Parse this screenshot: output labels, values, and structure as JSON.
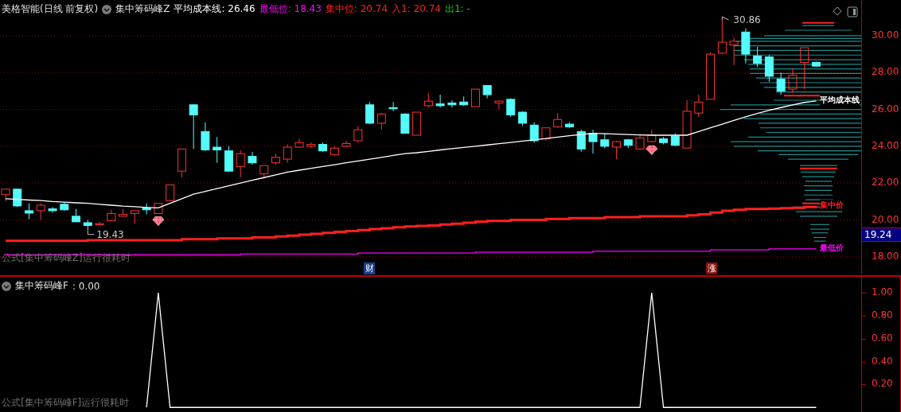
{
  "header": {
    "stock": "美格智能(日线 前复权)",
    "indicator": "集中筹码峰Z",
    "items": [
      {
        "label": "平均成本线:",
        "value": "26.46",
        "color": "#ffffff"
      },
      {
        "label": "最低位:",
        "value": "18.43",
        "color": "#ff00ff"
      },
      {
        "label": "集中位:",
        "value": "20.74",
        "color": "#ff2020"
      },
      {
        "label": "入1:",
        "value": "20.74",
        "color": "#ff2020"
      },
      {
        "label": "出1:",
        "value": "-",
        "color": "#00e000"
      }
    ]
  },
  "main_chart": {
    "high_marker": "30.86",
    "low_marker": "19.43",
    "price_tag": "19.24",
    "formula_note": "公式[集中筹码峰Z]运行很耗时",
    "badges": [
      {
        "text": "财",
        "kind": "finance"
      },
      {
        "text": "涨",
        "kind": "limit-up"
      }
    ],
    "chart_data": {
      "type": "candlestick",
      "grid": true,
      "ylim": [
        17.0,
        31.94
      ],
      "yticks": [
        {
          "value": 18,
          "label": "18.00"
        },
        {
          "value": 20,
          "label": "20.00"
        },
        {
          "value": 22,
          "label": "22.00"
        },
        {
          "value": 24,
          "label": "24.00"
        },
        {
          "value": 26,
          "label": "26.00"
        },
        {
          "value": 28,
          "label": "28.00"
        },
        {
          "value": 30,
          "label": "30.00"
        }
      ],
      "series": [
        {
          "name": "平均成本线",
          "type": "line",
          "color": "#ffffff",
          "values": [
            21.15,
            21.12,
            21.08,
            21.05,
            21.0,
            20.97,
            20.93,
            20.9,
            20.85,
            20.8,
            20.75,
            20.72,
            20.68,
            20.65,
            20.9,
            21.15,
            21.4,
            21.55,
            21.7,
            21.85,
            22.0,
            22.15,
            22.3,
            22.45,
            22.6,
            22.7,
            22.8,
            22.9,
            23.0,
            23.1,
            23.2,
            23.3,
            23.4,
            23.5,
            23.6,
            23.65,
            23.72,
            23.8,
            23.87,
            23.94,
            24.0,
            24.07,
            24.14,
            24.21,
            24.28,
            24.35,
            24.42,
            24.5,
            24.57,
            24.64,
            24.7,
            24.68,
            24.66,
            24.64,
            24.62,
            24.6,
            24.6,
            24.6,
            24.6,
            24.8,
            25.0,
            25.2,
            25.4,
            25.6,
            25.78,
            25.95,
            26.1,
            26.25,
            26.38,
            26.46
          ]
        },
        {
          "name": "集中价",
          "type": "line",
          "color": "#ff2020",
          "values": [
            18.87,
            18.87,
            18.87,
            18.87,
            18.87,
            18.87,
            18.87,
            18.9,
            18.9,
            18.9,
            18.9,
            18.9,
            18.9,
            18.9,
            18.9,
            18.95,
            18.95,
            18.95,
            19.0,
            19.0,
            19.0,
            19.05,
            19.05,
            19.1,
            19.15,
            19.2,
            19.25,
            19.3,
            19.35,
            19.4,
            19.45,
            19.5,
            19.55,
            19.6,
            19.65,
            19.68,
            19.7,
            19.75,
            19.8,
            19.85,
            19.9,
            19.95,
            19.95,
            20.0,
            20.0,
            20.0,
            20.05,
            20.05,
            20.1,
            20.1,
            20.1,
            20.15,
            20.15,
            20.15,
            20.2,
            20.2,
            20.2,
            20.2,
            20.25,
            20.3,
            20.4,
            20.5,
            20.55,
            20.6,
            20.6,
            20.62,
            20.64,
            20.66,
            20.7,
            20.74
          ]
        },
        {
          "name": "最低价",
          "type": "line",
          "color": "#ff00ff",
          "values": [
            18.1,
            18.1,
            18.1,
            18.1,
            18.1,
            18.1,
            18.1,
            18.1,
            18.1,
            18.1,
            18.1,
            18.1,
            18.1,
            18.1,
            18.1,
            18.1,
            18.1,
            18.1,
            18.1,
            18.1,
            18.15,
            18.15,
            18.15,
            18.15,
            18.15,
            18.15,
            18.15,
            18.15,
            18.15,
            18.15,
            18.2,
            18.2,
            18.2,
            18.2,
            18.2,
            18.2,
            18.2,
            18.2,
            18.2,
            18.2,
            18.25,
            18.25,
            18.25,
            18.25,
            18.25,
            18.25,
            18.25,
            18.25,
            18.25,
            18.25,
            18.3,
            18.3,
            18.3,
            18.3,
            18.3,
            18.3,
            18.3,
            18.3,
            18.3,
            18.3,
            18.38,
            18.38,
            18.38,
            18.38,
            18.38,
            18.43,
            18.43,
            18.43,
            18.43,
            18.43
          ]
        }
      ],
      "ohlc": [
        [
          21.37,
          21.67,
          21.0,
          21.67
        ],
        [
          21.67,
          21.7,
          20.7,
          20.76
        ],
        [
          20.5,
          20.9,
          20.05,
          20.37
        ],
        [
          20.5,
          20.9,
          20.0,
          20.8
        ],
        [
          20.6,
          20.7,
          20.4,
          20.5
        ],
        [
          20.85,
          20.95,
          20.5,
          20.55
        ],
        [
          20.2,
          20.6,
          19.9,
          19.9
        ],
        [
          19.85,
          20.0,
          19.43,
          19.7
        ],
        [
          19.75,
          19.9,
          19.7,
          19.8
        ],
        [
          19.95,
          20.55,
          19.95,
          20.35
        ],
        [
          20.2,
          20.6,
          20.2,
          20.3
        ],
        [
          20.35,
          20.5,
          19.8,
          20.5
        ],
        [
          20.65,
          20.9,
          20.3,
          20.55
        ],
        [
          20.35,
          20.9,
          20.35,
          20.9
        ],
        [
          21.05,
          21.9,
          21.0,
          21.9
        ],
        [
          22.65,
          23.85,
          22.3,
          23.85
        ],
        [
          26.25,
          26.3,
          23.85,
          25.7
        ],
        [
          24.8,
          25.3,
          23.75,
          23.8
        ],
        [
          23.95,
          24.5,
          23.1,
          23.8
        ],
        [
          23.75,
          24.0,
          22.6,
          22.65
        ],
        [
          22.9,
          23.8,
          22.3,
          23.6
        ],
        [
          23.45,
          23.7,
          23.0,
          23.1
        ],
        [
          22.5,
          22.95,
          22.3,
          22.95
        ],
        [
          23.1,
          23.6,
          23.0,
          23.4
        ],
        [
          23.3,
          24.1,
          23.1,
          23.95
        ],
        [
          23.95,
          24.4,
          23.9,
          24.2
        ],
        [
          24.0,
          24.2,
          23.9,
          24.1
        ],
        [
          24.1,
          24.2,
          23.7,
          23.75
        ],
        [
          23.55,
          24.0,
          23.5,
          23.9
        ],
        [
          24.0,
          24.3,
          23.95,
          24.15
        ],
        [
          24.3,
          25.1,
          24.2,
          24.9
        ],
        [
          26.25,
          26.4,
          25.2,
          25.25
        ],
        [
          25.25,
          25.8,
          24.9,
          25.75
        ],
        [
          26.1,
          26.4,
          25.9,
          26.05
        ],
        [
          25.75,
          25.8,
          24.7,
          24.7
        ],
        [
          24.6,
          25.85,
          24.6,
          25.85
        ],
        [
          26.2,
          26.9,
          26.1,
          26.45
        ],
        [
          26.3,
          26.8,
          26.1,
          26.2
        ],
        [
          26.35,
          26.5,
          26.1,
          26.25
        ],
        [
          26.4,
          26.7,
          26.2,
          26.25
        ],
        [
          26.15,
          27.1,
          26.15,
          27.1
        ],
        [
          27.3,
          27.3,
          26.6,
          26.8
        ],
        [
          26.35,
          26.5,
          26.0,
          26.45
        ],
        [
          26.55,
          26.6,
          25.6,
          25.7
        ],
        [
          25.85,
          25.9,
          25.1,
          25.25
        ],
        [
          25.15,
          25.3,
          24.2,
          24.3
        ],
        [
          24.4,
          25.0,
          24.3,
          25.0
        ],
        [
          25.05,
          25.8,
          25.0,
          25.45
        ],
        [
          25.2,
          25.3,
          25.0,
          25.05
        ],
        [
          24.8,
          24.9,
          23.7,
          23.85
        ],
        [
          24.7,
          24.9,
          23.6,
          24.25
        ],
        [
          24.35,
          24.7,
          23.9,
          24.0
        ],
        [
          23.95,
          24.3,
          23.3,
          24.25
        ],
        [
          24.35,
          24.4,
          23.9,
          24.05
        ],
        [
          23.85,
          24.6,
          23.8,
          24.45
        ],
        [
          24.25,
          24.9,
          24.2,
          24.6
        ],
        [
          24.4,
          24.5,
          24.1,
          24.2
        ],
        [
          24.55,
          24.7,
          24.0,
          24.05
        ],
        [
          23.9,
          26.5,
          23.9,
          25.9
        ],
        [
          25.8,
          26.8,
          25.6,
          26.4
        ],
        [
          26.55,
          29.1,
          26.55,
          29.0
        ],
        [
          29.05,
          30.86,
          29.0,
          29.65
        ],
        [
          29.5,
          29.9,
          28.4,
          29.7
        ],
        [
          30.2,
          30.4,
          28.5,
          29.0
        ],
        [
          28.9,
          29.4,
          28.3,
          28.5
        ],
        [
          28.85,
          28.95,
          27.5,
          27.8
        ],
        [
          27.65,
          28.0,
          26.8,
          27.0
        ],
        [
          27.1,
          28.25,
          26.9,
          27.85
        ],
        [
          28.55,
          29.35,
          27.1,
          29.35
        ],
        [
          28.55,
          28.6,
          28.3,
          28.35
        ]
      ]
    }
  },
  "sub_chart": {
    "value": ": 0.00",
    "formula_note": "公式[集中筹码峰F]运行很耗时",
    "chart_data": {
      "type": "line",
      "ylim": [
        -0.04,
        1.14
      ],
      "yticks": [
        {
          "value": 0.2,
          "label": "0.20"
        },
        {
          "value": 0.4,
          "label": "0.40"
        },
        {
          "value": 0.6,
          "label": "0.60"
        },
        {
          "value": 0.8,
          "label": "0.80"
        },
        {
          "value": 1,
          "label": "1.00"
        }
      ],
      "series": [
        {
          "name": "集中筹码峰F",
          "color": "#ffffff",
          "values": [
            null,
            null,
            null,
            null,
            null,
            null,
            null,
            null,
            null,
            null,
            null,
            null,
            0,
            1,
            0,
            0,
            0,
            0,
            0,
            0,
            0,
            0,
            0,
            0,
            0,
            0,
            0,
            0,
            0,
            0,
            0,
            0,
            0,
            0,
            0,
            0,
            0,
            0,
            0,
            0,
            0,
            0,
            0,
            0,
            0,
            0,
            0,
            0,
            0,
            0,
            0,
            0,
            0,
            0,
            0,
            1,
            0,
            0,
            0,
            0,
            0,
            0,
            0,
            0,
            0,
            0,
            0,
            0,
            0,
            0
          ]
        }
      ]
    }
  }
}
